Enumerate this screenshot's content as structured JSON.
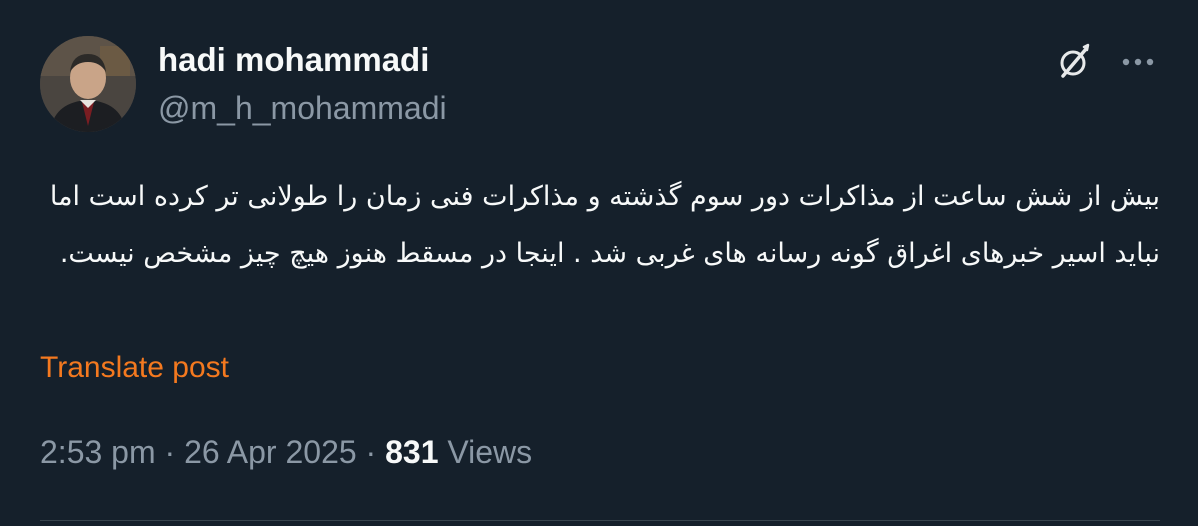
{
  "author": {
    "display_name": "hadi mohammadi",
    "handle": "@m_h_mohammadi"
  },
  "post": {
    "text": "بیش از شش ساعت از مذاکرات دور سوم گذشته و مذاکرات فنی زمان را طولانی تر کرده است اما نباید اسیر خبرهای اغراق گونه رسانه های غربی شد . اینجا در مسقط هنوز هیچ چیز مشخص نیست.",
    "translate_label": "Translate post"
  },
  "meta": {
    "time": "2:53 pm",
    "separator": " · ",
    "date": "26 Apr 2025",
    "views_count": "831",
    "views_label": " Views"
  },
  "icons": {
    "grok": "grok-icon",
    "more": "more-icon",
    "avatar": "avatar"
  },
  "colors": {
    "background": "#15202b",
    "primary_text": "#f7f9f9",
    "secondary_text": "#8b98a5",
    "accent": "#f4791f"
  }
}
